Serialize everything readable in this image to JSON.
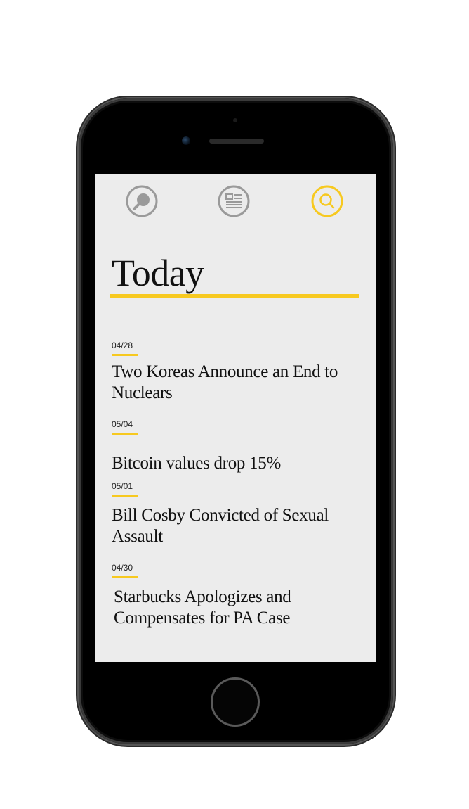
{
  "nav": {
    "items": [
      {
        "icon": "explore-icon",
        "active": false
      },
      {
        "icon": "news-icon",
        "active": false
      },
      {
        "icon": "search-icon",
        "active": true
      }
    ],
    "colors": {
      "inactive": "#9a9a9a",
      "active": "#f7c91f"
    }
  },
  "page": {
    "title": "Today",
    "accent_color": "#f7c91f"
  },
  "news": [
    {
      "date": "04/28",
      "headline": "Two Koreas Announce an End to Nuclears"
    },
    {
      "date": "05/04",
      "headline": "Bitcoin values drop 15%"
    },
    {
      "date": "05/01",
      "headline": "Bill Cosby Convicted of Sexual Assault"
    },
    {
      "date": "04/30",
      "headline": "Starbucks Apologizes and Compensates for PA Case"
    }
  ]
}
